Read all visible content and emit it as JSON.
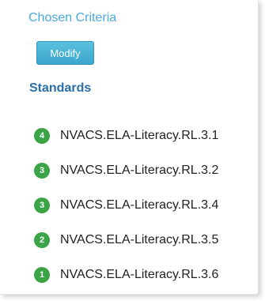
{
  "criteria": {
    "title": "Chosen Criteria",
    "modify_label": "Modify"
  },
  "standards": {
    "heading": "Standards",
    "items": [
      {
        "count": "4",
        "label": "NVACS.ELA-Literacy.RL.3.1"
      },
      {
        "count": "3",
        "label": "NVACS.ELA-Literacy.RL.3.2"
      },
      {
        "count": "3",
        "label": "NVACS.ELA-Literacy.RL.3.4"
      },
      {
        "count": "2",
        "label": "NVACS.ELA-Literacy.RL.3.5"
      },
      {
        "count": "1",
        "label": "NVACS.ELA-Literacy.RL.3.6"
      }
    ]
  },
  "colors": {
    "title_blue": "#4aa8dc",
    "button_blue": "#3aa6cd",
    "heading_blue": "#2a6fa8",
    "badge_green": "#3aa446"
  }
}
